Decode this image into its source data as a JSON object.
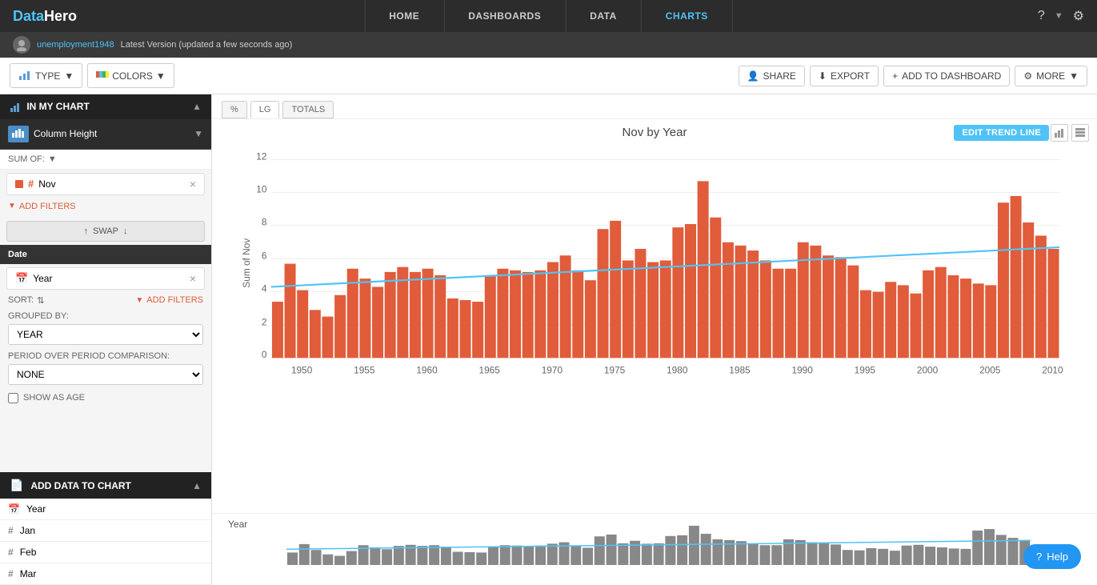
{
  "app": {
    "name": "DataHero",
    "logo_text": "DataHero"
  },
  "nav": {
    "links": [
      {
        "label": "HOME",
        "active": false
      },
      {
        "label": "DASHBOARDS",
        "active": false
      },
      {
        "label": "DATA",
        "active": false
      },
      {
        "label": "CHARTS",
        "active": true
      }
    ]
  },
  "sub_header": {
    "filename": "unemployment1948",
    "status": "Latest Version (updated a few seconds ago)"
  },
  "toolbar": {
    "type_label": "TYPE",
    "colors_label": "COLORS",
    "share_label": "SHARE",
    "export_label": "EXPORT",
    "add_dashboard_label": "ADD TO DASHBOARD",
    "more_label": "MORE"
  },
  "sidebar": {
    "in_my_chart": "IN MY CHART",
    "column_height": "Column Height",
    "sum_of": "SUM OF:",
    "field_nov": "Nov",
    "add_filters": "ADD FILTERS",
    "swap": "SWAP",
    "date_label": "Date",
    "year_label": "Year",
    "sort_label": "SORT:",
    "add_filters2": "ADD FILTERS",
    "grouped_by": "GROUPED BY:",
    "grouped_by_value": "YEAR",
    "period_over_period": "PERIOD OVER PERIOD COMPARISON:",
    "none_value": "NONE",
    "show_as_age": "SHOW AS AGE",
    "add_data_label": "ADD DATA TO CHART",
    "fields": [
      {
        "type": "cal",
        "label": "Year"
      },
      {
        "type": "hash",
        "label": "Jan"
      },
      {
        "type": "hash",
        "label": "Feb"
      },
      {
        "type": "hash",
        "label": "Mar"
      }
    ]
  },
  "chart": {
    "title": "Nov by Year",
    "edit_trend_label": "EDIT TREND LINE",
    "tab_percent": "%",
    "tab_lg": "LG",
    "tab_totals": "TOTALS",
    "x_axis_label": "Year",
    "y_axis_label": "Sum of Nov",
    "mini_label": "Year",
    "y_values": [
      0,
      2,
      4,
      6,
      8,
      10,
      12
    ],
    "x_labels": [
      "1950",
      "1955",
      "1960",
      "1965",
      "1970",
      "1975",
      "1980",
      "1985",
      "1990",
      "1995",
      "2000",
      "2005",
      "2010"
    ],
    "bar_color": "#e05c3a",
    "trend_color": "#4fc3f7",
    "bars": [
      {
        "year": 1948,
        "val": 3.4
      },
      {
        "year": 1949,
        "val": 5.7
      },
      {
        "year": 1950,
        "val": 4.1
      },
      {
        "year": 1951,
        "val": 2.9
      },
      {
        "year": 1952,
        "val": 2.5
      },
      {
        "year": 1953,
        "val": 3.8
      },
      {
        "year": 1954,
        "val": 5.4
      },
      {
        "year": 1955,
        "val": 4.8
      },
      {
        "year": 1956,
        "val": 4.3
      },
      {
        "year": 1957,
        "val": 5.2
      },
      {
        "year": 1958,
        "val": 5.5
      },
      {
        "year": 1959,
        "val": 5.2
      },
      {
        "year": 1960,
        "val": 5.4
      },
      {
        "year": 1961,
        "val": 5.0
      },
      {
        "year": 1962,
        "val": 3.6
      },
      {
        "year": 1963,
        "val": 3.5
      },
      {
        "year": 1964,
        "val": 3.4
      },
      {
        "year": 1965,
        "val": 5.0
      },
      {
        "year": 1966,
        "val": 5.4
      },
      {
        "year": 1967,
        "val": 5.3
      },
      {
        "year": 1968,
        "val": 5.2
      },
      {
        "year": 1969,
        "val": 5.3
      },
      {
        "year": 1970,
        "val": 5.8
      },
      {
        "year": 1971,
        "val": 6.2
      },
      {
        "year": 1972,
        "val": 5.3
      },
      {
        "year": 1973,
        "val": 4.7
      },
      {
        "year": 1974,
        "val": 7.8
      },
      {
        "year": 1975,
        "val": 8.3
      },
      {
        "year": 1976,
        "val": 5.9
      },
      {
        "year": 1977,
        "val": 6.6
      },
      {
        "year": 1978,
        "val": 5.8
      },
      {
        "year": 1979,
        "val": 5.9
      },
      {
        "year": 1980,
        "val": 7.9
      },
      {
        "year": 1981,
        "val": 8.1
      },
      {
        "year": 1982,
        "val": 10.7
      },
      {
        "year": 1983,
        "val": 8.5
      },
      {
        "year": 1984,
        "val": 7.0
      },
      {
        "year": 1985,
        "val": 6.8
      },
      {
        "year": 1986,
        "val": 6.5
      },
      {
        "year": 1987,
        "val": 5.9
      },
      {
        "year": 1988,
        "val": 5.4
      },
      {
        "year": 1989,
        "val": 5.4
      },
      {
        "year": 1990,
        "val": 7.0
      },
      {
        "year": 1991,
        "val": 6.8
      },
      {
        "year": 1992,
        "val": 6.2
      },
      {
        "year": 1993,
        "val": 6.1
      },
      {
        "year": 1994,
        "val": 5.6
      },
      {
        "year": 1995,
        "val": 4.1
      },
      {
        "year": 1996,
        "val": 4.0
      },
      {
        "year": 1997,
        "val": 4.6
      },
      {
        "year": 1998,
        "val": 4.4
      },
      {
        "year": 1999,
        "val": 3.9
      },
      {
        "year": 2000,
        "val": 5.3
      },
      {
        "year": 2001,
        "val": 5.5
      },
      {
        "year": 2002,
        "val": 5.0
      },
      {
        "year": 2003,
        "val": 4.8
      },
      {
        "year": 2004,
        "val": 4.5
      },
      {
        "year": 2005,
        "val": 4.4
      },
      {
        "year": 2006,
        "val": 9.4
      },
      {
        "year": 2007,
        "val": 9.8
      },
      {
        "year": 2008,
        "val": 8.2
      },
      {
        "year": 2009,
        "val": 7.4
      },
      {
        "year": 2010,
        "val": 6.6
      }
    ]
  },
  "help": {
    "label": "Help"
  }
}
